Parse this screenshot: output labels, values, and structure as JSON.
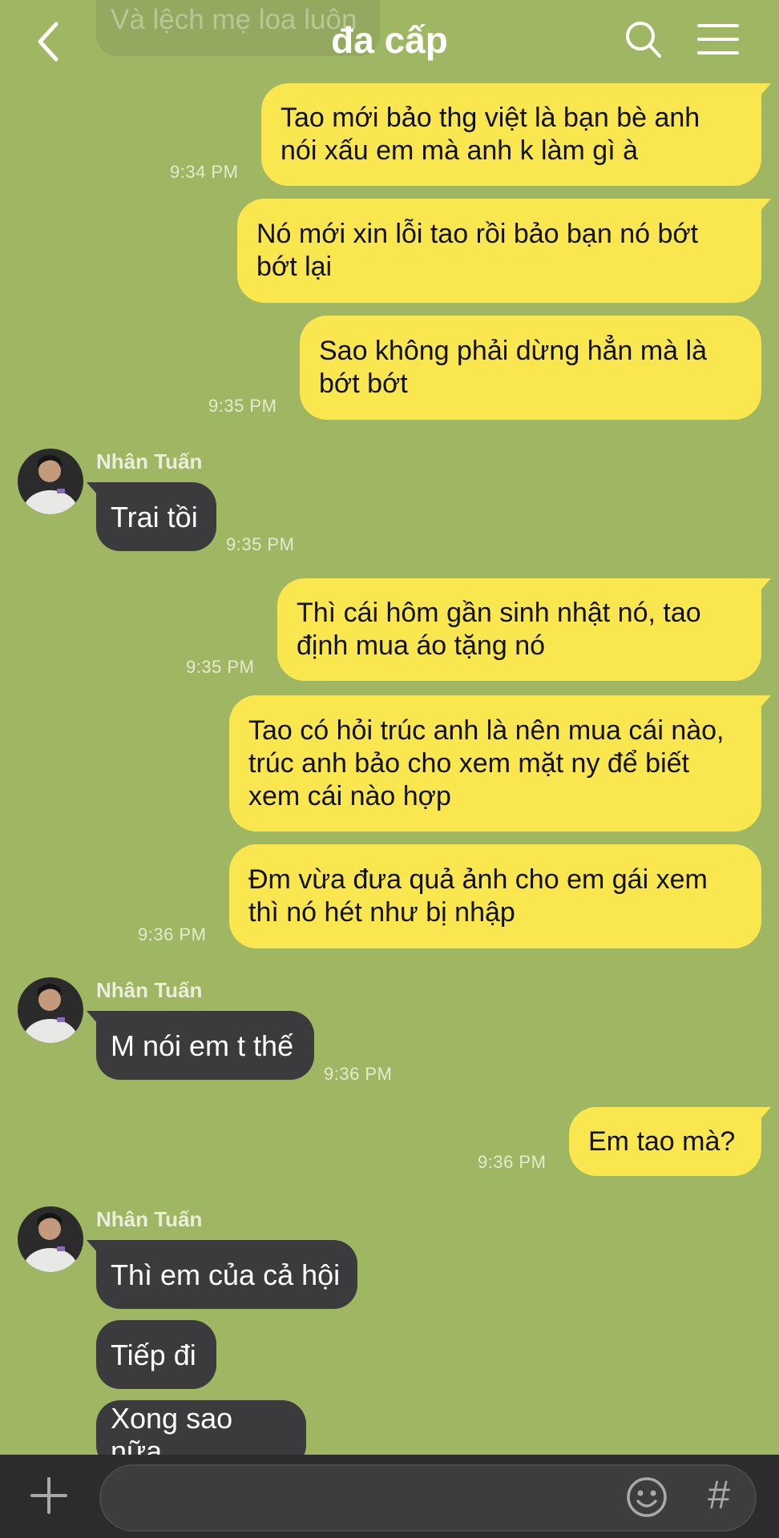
{
  "header": {
    "title": "đa cấp",
    "partial_message": "Và lệch mẹ loa luôn"
  },
  "colors": {
    "background": "#9fb662",
    "sent_bubble": "#fae750",
    "received_bubble": "#3b3b3d",
    "bottom_bar": "#2c2c2e"
  },
  "messages": [
    {
      "text": "Tao mới bảo thg việt là bạn bè anh nói xấu em mà anh k làm gì à",
      "time": "9:34 PM"
    },
    {
      "text": "Nó mới xin lỗi tao rồi bảo bạn nó bớt bớt lại"
    },
    {
      "text": "Sao không phải dừng hẳn mà là bớt bớt",
      "time": "9:35 PM"
    },
    {
      "sender": "Nhân Tuấn",
      "text": "Trai tồi",
      "time": "9:35 PM"
    },
    {
      "text": "Thì cái hôm gần sinh nhật nó, tao định mua áo tặng nó",
      "time": "9:35 PM"
    },
    {
      "text": "Tao có hỏi trúc anh là nên mua cái nào, trúc anh bảo cho xem mặt ny để biết xem cái nào hợp"
    },
    {
      "text": "Đm vừa đưa quả ảnh cho em gái xem thì nó hét như bị nhập",
      "time": "9:36 PM"
    },
    {
      "sender": "Nhân Tuấn",
      "text": "M nói em t thế",
      "time": "9:36 PM"
    },
    {
      "text": "Em tao mà?",
      "time": "9:36 PM"
    },
    {
      "sender": "Nhân Tuấn",
      "text": "Thì em của cả hội"
    },
    {
      "text": "Tiếp đi"
    },
    {
      "text": "Xong sao nữa"
    }
  ],
  "input": {
    "placeholder": ""
  },
  "icons": {
    "back": "chevron-left-icon",
    "search": "search-icon",
    "menu": "hamburger-menu-icon",
    "plus": "plus-icon",
    "emoji": "emoji-icon",
    "hash": "#"
  }
}
